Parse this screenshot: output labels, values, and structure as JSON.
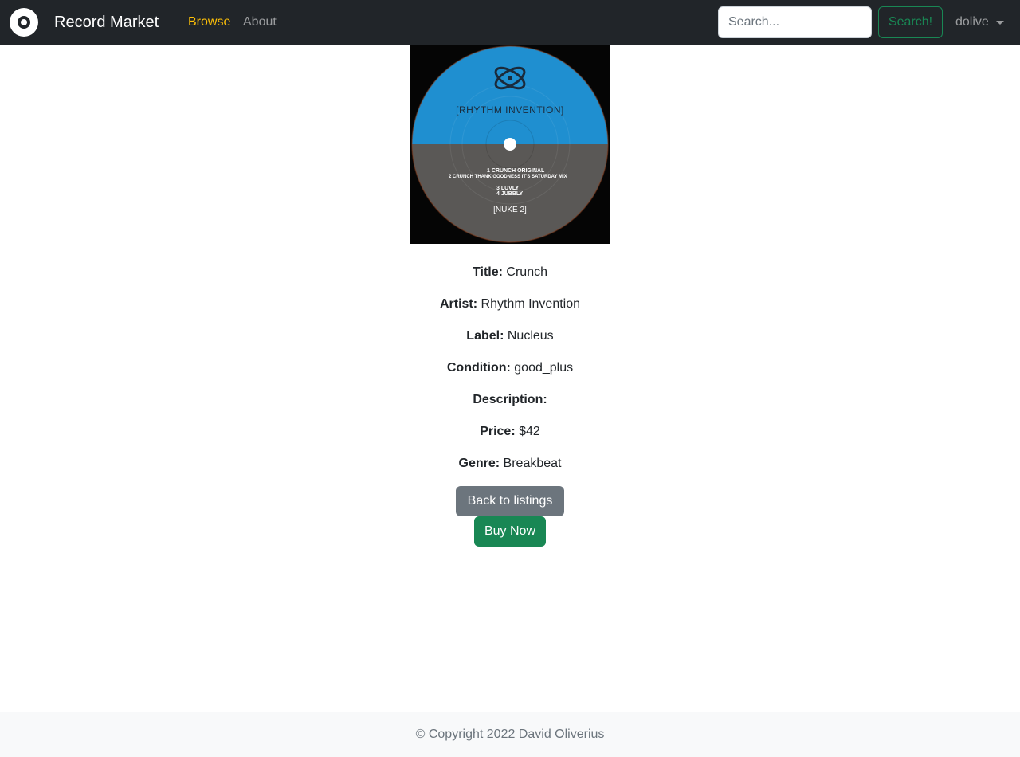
{
  "navbar": {
    "brand": "Record Market",
    "links": [
      {
        "label": "Browse",
        "active": true
      },
      {
        "label": "About",
        "active": false
      }
    ],
    "search": {
      "placeholder": "Search...",
      "value": "",
      "button_label": "Search!"
    },
    "user": "dolive"
  },
  "record": {
    "cover_art": {
      "top_text": "[RHYTHM INVENTION]",
      "tracks": [
        "1 CRUNCH ORIGINAL",
        "2 CRUNCH THANK GOODNESS IT'S SATURDAY MIX",
        "3 LUVLY",
        "4 JUBBLY"
      ],
      "catalog": "[NUKE 2]"
    },
    "fields": [
      {
        "label": "Title:",
        "value": "Crunch"
      },
      {
        "label": "Artist:",
        "value": "Rhythm Invention"
      },
      {
        "label": "Label:",
        "value": "Nucleus"
      },
      {
        "label": "Condition:",
        "value": "good_plus"
      },
      {
        "label": "Description:",
        "value": ""
      },
      {
        "label": "Price:",
        "value": "$42"
      },
      {
        "label": "Genre:",
        "value": "Breakbeat"
      }
    ]
  },
  "actions": {
    "back_label": "Back to listings",
    "buy_label": "Buy Now"
  },
  "footer": {
    "copyright": "© Copyright 2022 David Oliverius"
  },
  "colors": {
    "navbar": "#212529",
    "active_link": "#ffc107",
    "success": "#198754",
    "secondary": "#6c757d",
    "footer_bg": "#f8f9fa"
  }
}
